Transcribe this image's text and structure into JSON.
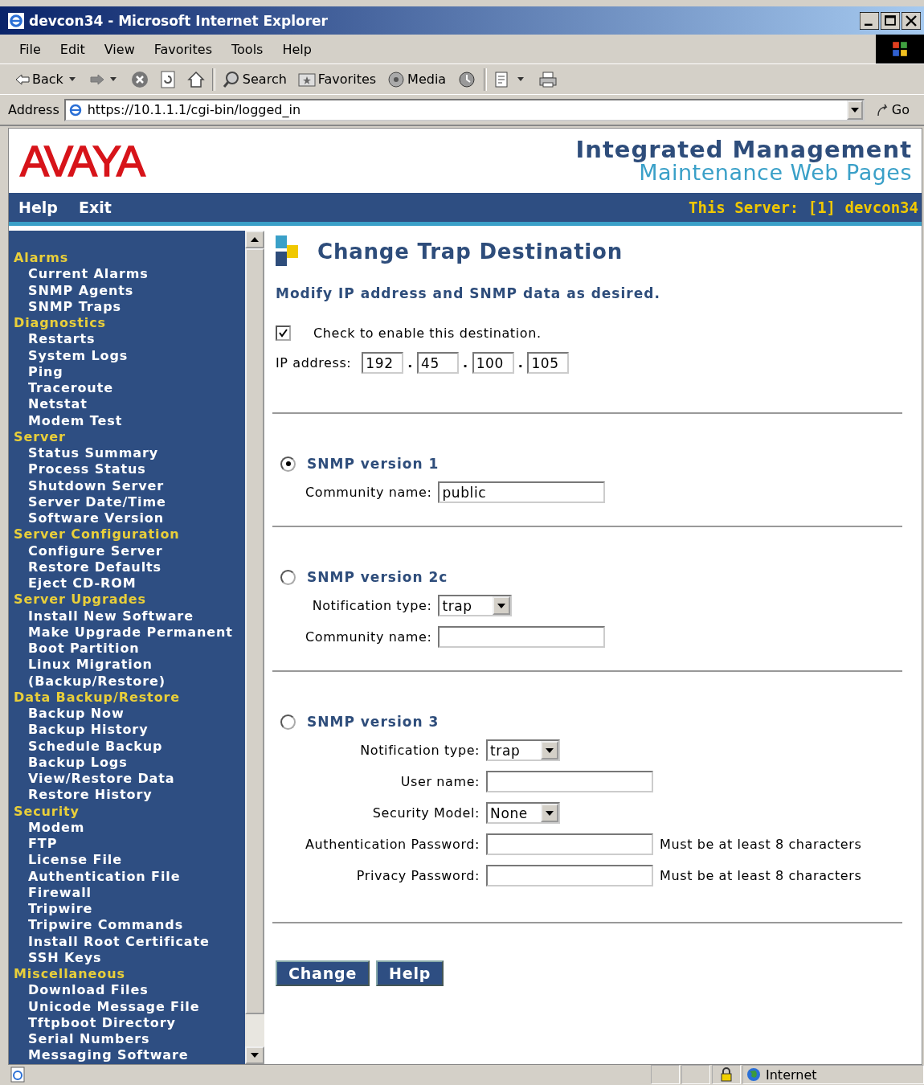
{
  "window": {
    "title": "devcon34 - Microsoft Internet Explorer"
  },
  "menu": [
    "File",
    "Edit",
    "View",
    "Favorites",
    "Tools",
    "Help"
  ],
  "toolbar": [
    {
      "kind": "back",
      "label": "Back"
    },
    {
      "kind": "forward"
    },
    {
      "kind": "stop"
    },
    {
      "kind": "refresh"
    },
    {
      "kind": "home"
    },
    {
      "kind": "search",
      "label": "Search"
    },
    {
      "kind": "favorites",
      "label": "Favorites"
    },
    {
      "kind": "media",
      "label": "Media"
    },
    {
      "kind": "history"
    },
    {
      "kind": "mail"
    },
    {
      "kind": "print"
    }
  ],
  "address": {
    "label": "Address",
    "value": "https://10.1.1.1/cgi-bin/logged_in",
    "go": "Go"
  },
  "header": {
    "logo": "AVAYA",
    "title": "Integrated Management",
    "subtitle": "Maintenance Web Pages"
  },
  "nav": {
    "links": [
      "Help",
      "Exit"
    ],
    "server": "This Server: [1] devcon34"
  },
  "sidebar": [
    {
      "heading": "Alarms",
      "items": [
        "Current Alarms",
        "SNMP Agents",
        "SNMP Traps"
      ]
    },
    {
      "heading": "Diagnostics",
      "items": [
        "Restarts",
        "System Logs",
        "Ping",
        "Traceroute",
        "Netstat",
        "Modem Test"
      ]
    },
    {
      "heading": "Server",
      "items": [
        "Status Summary",
        "Process Status",
        "Shutdown Server",
        "Server Date/Time",
        "Software Version"
      ]
    },
    {
      "heading": "Server Configuration",
      "items": [
        "Configure Server",
        "Restore Defaults",
        "Eject CD-ROM"
      ]
    },
    {
      "heading": "Server Upgrades",
      "items": [
        "Install New Software",
        "Make Upgrade Permanent",
        "Boot Partition",
        "Linux Migration\n(Backup/Restore)"
      ]
    },
    {
      "heading": "Data Backup/Restore",
      "items": [
        "Backup Now",
        "Backup History",
        "Schedule Backup",
        "Backup Logs",
        "View/Restore Data",
        "Restore History"
      ]
    },
    {
      "heading": "Security",
      "items": [
        "Modem",
        "FTP",
        "License File",
        "Authentication File",
        "Firewall",
        "Tripwire",
        "Tripwire Commands",
        "Install Root Certificate",
        "SSH Keys"
      ]
    },
    {
      "heading": "Miscellaneous",
      "items": [
        "Download Files",
        "Unicode Message File",
        "Tftpboot Directory",
        "Serial Numbers",
        "Messaging Software"
      ]
    }
  ],
  "content": {
    "title": "Change Trap Destination",
    "instruction": "Modify IP address and SNMP data as desired.",
    "enable": {
      "label": "Check to enable this destination.",
      "checked": true
    },
    "ip": {
      "label": "IP address:",
      "octets": [
        "192",
        "45",
        "100",
        "105"
      ],
      "separator": "."
    },
    "versions": [
      {
        "label": "SNMP version 1",
        "selected": true,
        "fields": [
          {
            "kind": "text",
            "label": "Community name:",
            "value": "public"
          }
        ]
      },
      {
        "label": "SNMP version 2c",
        "selected": false,
        "fields": [
          {
            "kind": "select",
            "label": "Notification type:",
            "value": "trap"
          },
          {
            "kind": "text",
            "label": "Community name:"
          }
        ]
      },
      {
        "label": "SNMP version 3",
        "selected": false,
        "fields": [
          {
            "kind": "select",
            "label": "Notification type:",
            "value": "trap"
          },
          {
            "kind": "text",
            "label": "User name:"
          },
          {
            "kind": "select",
            "label": "Security Model:",
            "value": "None"
          },
          {
            "kind": "text",
            "label": "Authentication Password:",
            "note": "Must be at least 8 characters"
          },
          {
            "kind": "text",
            "label": "Privacy Password:",
            "note": "Must be at least 8 characters"
          }
        ]
      }
    ],
    "buttons": [
      "Change",
      "Help"
    ]
  },
  "status_bar": {
    "zone": "Internet"
  }
}
